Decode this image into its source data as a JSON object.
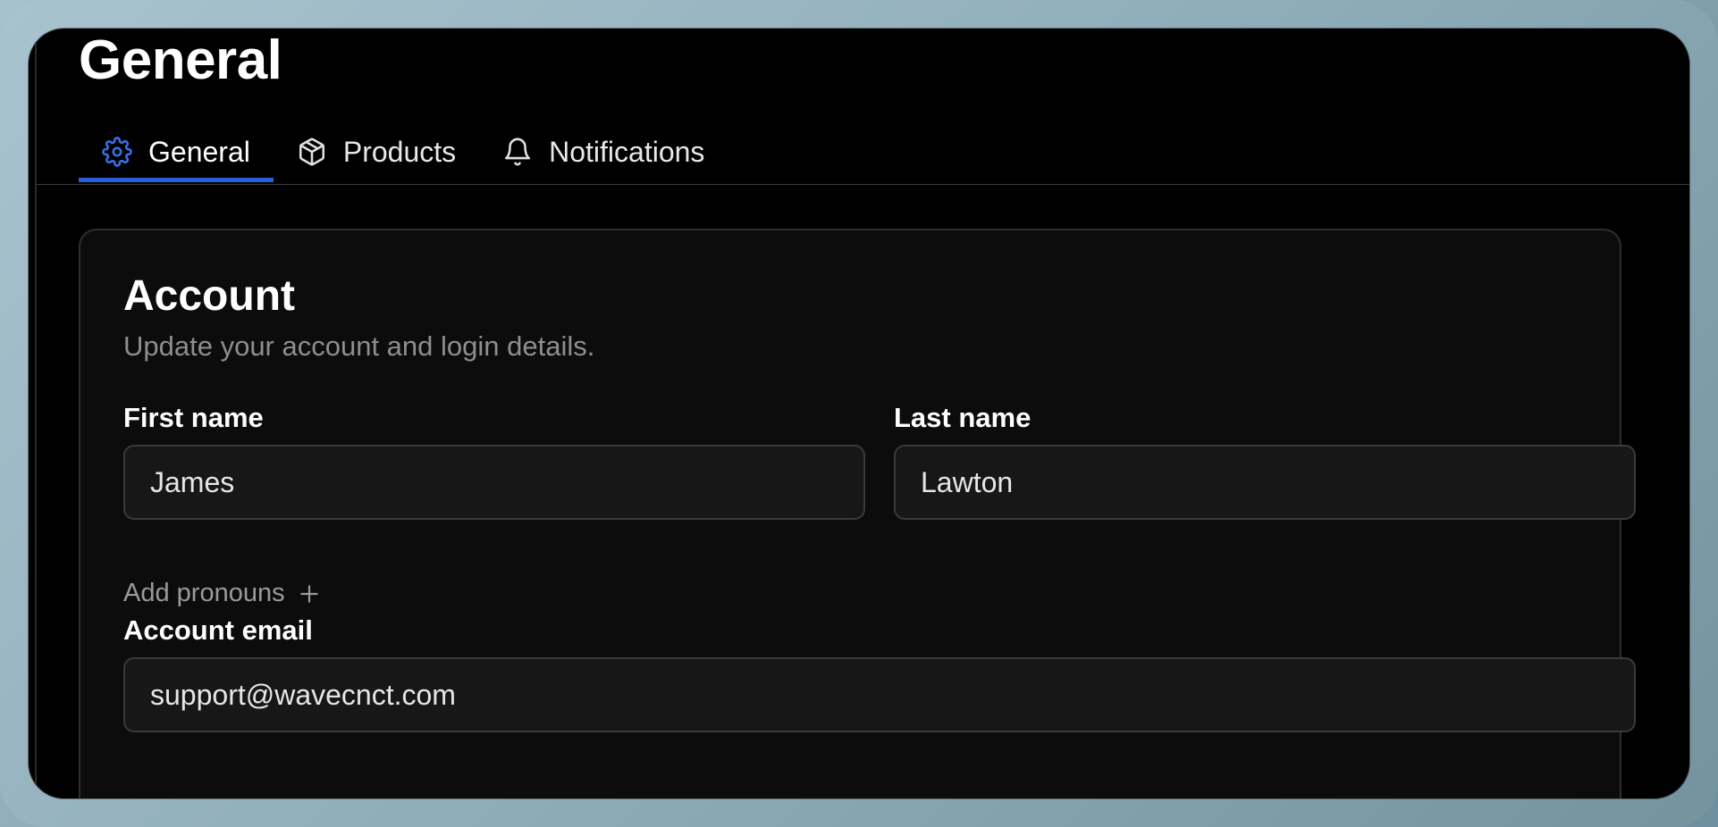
{
  "page": {
    "title": "General"
  },
  "tabs": [
    {
      "label": "General",
      "icon": "gear-icon",
      "active": true
    },
    {
      "label": "Products",
      "icon": "box-icon",
      "active": false
    },
    {
      "label": "Notifications",
      "icon": "bell-icon",
      "active": false
    }
  ],
  "account": {
    "title": "Account",
    "subtitle": "Update your account and login details.",
    "first_name": {
      "label": "First name",
      "value": "James"
    },
    "last_name": {
      "label": "Last name",
      "value": "Lawton"
    },
    "add_pronouns": {
      "label": "Add pronouns",
      "icon": "plus-icon"
    },
    "email": {
      "label": "Account email",
      "value": "support@wavecnct.com"
    }
  },
  "colors": {
    "accent": "#2b5fd9",
    "background": "#000000",
    "card": "#0c0c0c",
    "input": "#171717",
    "muted_text": "#8e8e8e"
  }
}
